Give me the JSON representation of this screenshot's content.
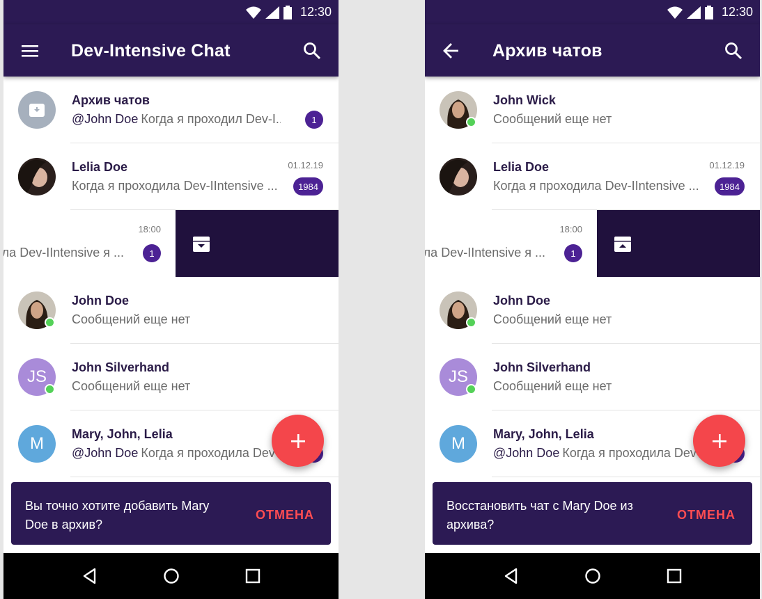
{
  "status": {
    "time": "12:30"
  },
  "screens": {
    "left": {
      "title": "Dev-Intensive Chat",
      "nav_icon": "menu-icon",
      "search_icon": "search-icon",
      "rows": [
        {
          "title": "Архив чатов",
          "author": "@John Doe",
          "sub": "Когда я проходил Dev-I...",
          "badge": "1"
        },
        {
          "title": "Lelia Doe",
          "sub": "Когда я проходила Dev-IIntensive ...",
          "date": "01.12.19",
          "badge": "1984"
        }
      ],
      "swipe": {
        "time": "18:00",
        "text": "ила Dev-IIntensive я ...",
        "badge": "1",
        "action_icon": "archive-icon"
      },
      "rows_after": [
        {
          "title": "John Doe",
          "sub": "Сообщений еще нет"
        },
        {
          "title": "John Silverhand",
          "initials": "JS",
          "sub": "Сообщений еще нет"
        },
        {
          "title": "Mary, John, Lelia",
          "initials": "M",
          "author": "@John Doe",
          "sub": "Когда я проходила Dev-I..."
        }
      ],
      "snackbar": {
        "text": "Вы точно хотите добавить Mary Doe в архив?",
        "action": "ОТМЕНА"
      }
    },
    "right": {
      "title": "Архив чатов",
      "nav_icon": "arrow-back-icon",
      "search_icon": "search-icon",
      "rows": [
        {
          "title": "John Wick",
          "sub": "Сообщений еще нет"
        },
        {
          "title": "Lelia Doe",
          "sub": "Когда я проходила Dev-IIntensive ...",
          "date": "01.12.19",
          "badge": "1984"
        }
      ],
      "swipe": {
        "time": "18:00",
        "text": "ила Dev-IIntensive я ...",
        "badge": "1",
        "action_icon": "unarchive-icon"
      },
      "rows_after": [
        {
          "title": "John Doe",
          "sub": "Сообщений еще нет"
        },
        {
          "title": "John Silverhand",
          "initials": "JS",
          "sub": "Сообщений еще нет"
        },
        {
          "title": "Mary, John, Lelia",
          "initials": "M",
          "author": "@John Doe",
          "sub": "Когда я проходила Dev-I..."
        }
      ],
      "snackbar": {
        "text": "Восстановить чат с Mary Doe из архива?",
        "action": "ОТМЕНА"
      }
    }
  },
  "colors": {
    "primary": "#2c1a54",
    "accent": "#f4464b",
    "badge": "#4c2294",
    "online": "#54d158",
    "swipe_action": "#20113d",
    "avatar_js": "#a98bd9",
    "avatar_m": "#5fa8dc",
    "avatar_archive": "#a6b0bd"
  }
}
